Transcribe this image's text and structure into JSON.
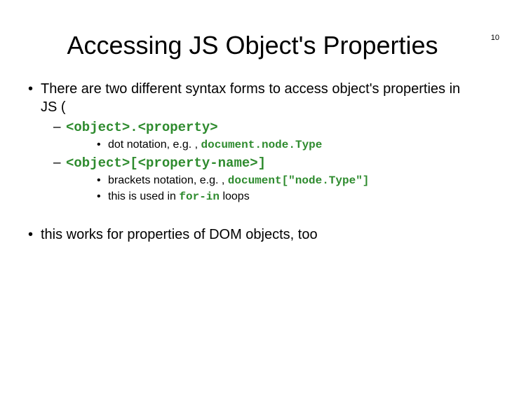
{
  "page_number": "10",
  "title": "Accessing JS Object's Properties",
  "b1_lead": "There are two different syntax forms to access object's properties in JS (",
  "s1_pre": "<object>.",
  "s1_post": "<property>",
  "s1d_pre": "dot notation, e.g. , ",
  "s1d_code": "document.node.Type",
  "s2_pre": "<object>[",
  "s2_mid": "<property-name>",
  "s2_post": "]",
  "s2d1_pre": "brackets notation, e.g. , ",
  "s2d1_code": "document[\"node.Type\"]",
  "s2d2_pre": "this is used in ",
  "s2d2_code": "for-in",
  "s2d2_post": " loops",
  "b2": "this works for properties of DOM objects, too"
}
